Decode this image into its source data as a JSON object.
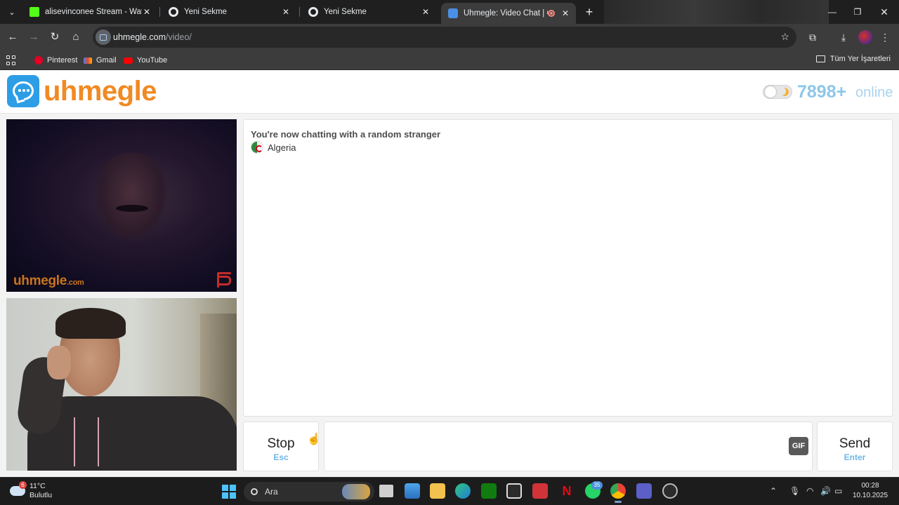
{
  "browser": {
    "tabs": [
      {
        "title": "alisevinconee Stream - Watch Li",
        "favicon_color": "#53fc18",
        "active": false
      },
      {
        "title": "Yeni Sekme",
        "favicon_color": "#e8eaed",
        "active": false
      },
      {
        "title": "Yeni Sekme",
        "favicon_color": "#e8eaed",
        "active": false
      },
      {
        "title": "Uhmegle: Video Chat | Omeg",
        "favicon_color": "#4a8fe7",
        "active": true
      }
    ],
    "tab_close_glyph": "✕",
    "new_tab_glyph": "+",
    "url_host": "uhmegle.com",
    "url_path": "/video/",
    "bookmarks": [
      {
        "label": "Pinterest",
        "icon": "pinterest-icon",
        "color": "#e60023"
      },
      {
        "label": "Gmail",
        "icon": "gmail-icon",
        "color": "#ea4335"
      },
      {
        "label": "YouTube",
        "icon": "youtube-icon",
        "color": "#ff0000"
      }
    ],
    "all_bookmarks_label": "Tüm Yer İşaretleri"
  },
  "site": {
    "logo_text": "uhmegle",
    "brand_color": "#f08a24",
    "online_count": "7898+",
    "online_label": "online",
    "watermark": "uhmegle",
    "watermark_suffix": ".com"
  },
  "chat": {
    "status_text": "You're now chatting with a random stranger",
    "country": "Algeria",
    "stop_label": "Stop",
    "stop_shortcut": "Esc",
    "message_value": "",
    "gif_label": "GIF",
    "send_label": "Send",
    "send_shortcut": "Enter"
  },
  "taskbar": {
    "weather_temp": "11°C",
    "weather_desc": "Bulutlu",
    "weather_badge": "6",
    "search_placeholder": "Ara",
    "whatsapp_badge": "35",
    "time": "00:28",
    "date": "10.10.2025"
  }
}
